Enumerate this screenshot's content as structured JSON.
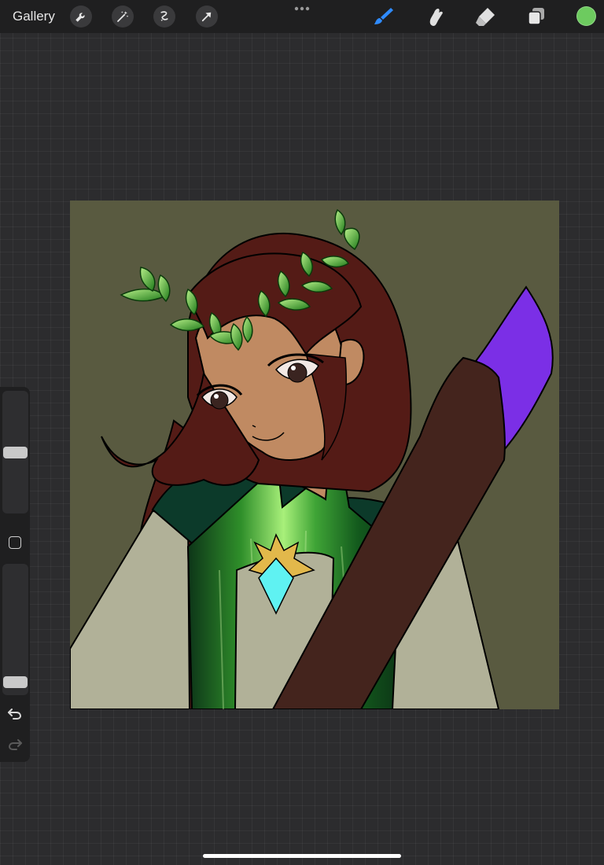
{
  "topbar": {
    "gallery_label": "Gallery",
    "left_tools": [
      "wrench-icon",
      "magic-wand-icon",
      "selection-icon",
      "transform-arrow-icon"
    ],
    "right_tools": [
      "brush-icon",
      "smudge-icon",
      "eraser-icon",
      "layers-icon"
    ],
    "active_tool": "brush",
    "current_color": "#6dcb5f"
  },
  "sidebar": {
    "brush_size": 0.5,
    "opacity": 0.05
  },
  "colors": {
    "accent": "#2f8bff",
    "canvas_background": "#595a40",
    "hair": "#541b16",
    "skin": "#c08a62",
    "cloak": "#b1b198",
    "staff": "#44241d",
    "staff_tip": "#7b2fe6",
    "gem": "#5ff2f2"
  }
}
